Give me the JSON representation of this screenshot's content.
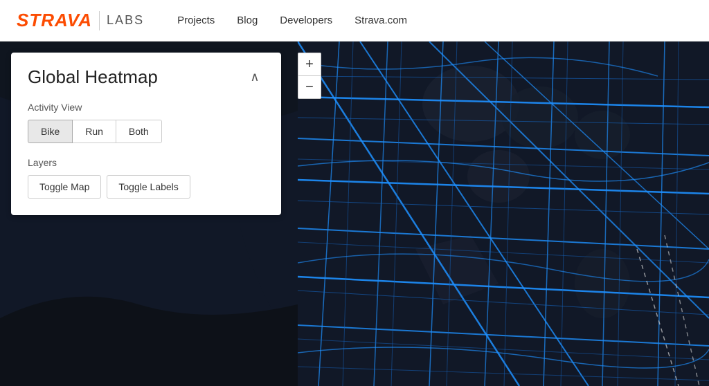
{
  "header": {
    "logo": "STRAVA",
    "labs": "LABS",
    "nav": [
      {
        "label": "Projects",
        "id": "projects"
      },
      {
        "label": "Blog",
        "id": "blog"
      },
      {
        "label": "Developers",
        "id": "developers"
      },
      {
        "label": "Strava.com",
        "id": "strava-com"
      }
    ]
  },
  "zoom": {
    "plus": "+",
    "minus": "−"
  },
  "panel": {
    "title": "Global Heatmap",
    "collapse_icon": "∧",
    "activity_view_label": "Activity View",
    "activity_buttons": [
      {
        "label": "Bike",
        "id": "bike",
        "active": true
      },
      {
        "label": "Run",
        "id": "run",
        "active": false
      },
      {
        "label": "Both",
        "id": "both",
        "active": false
      }
    ],
    "layers_label": "Layers",
    "layer_buttons": [
      {
        "label": "Toggle Map",
        "id": "toggle-map"
      },
      {
        "label": "Toggle Labels",
        "id": "toggle-labels"
      }
    ]
  }
}
